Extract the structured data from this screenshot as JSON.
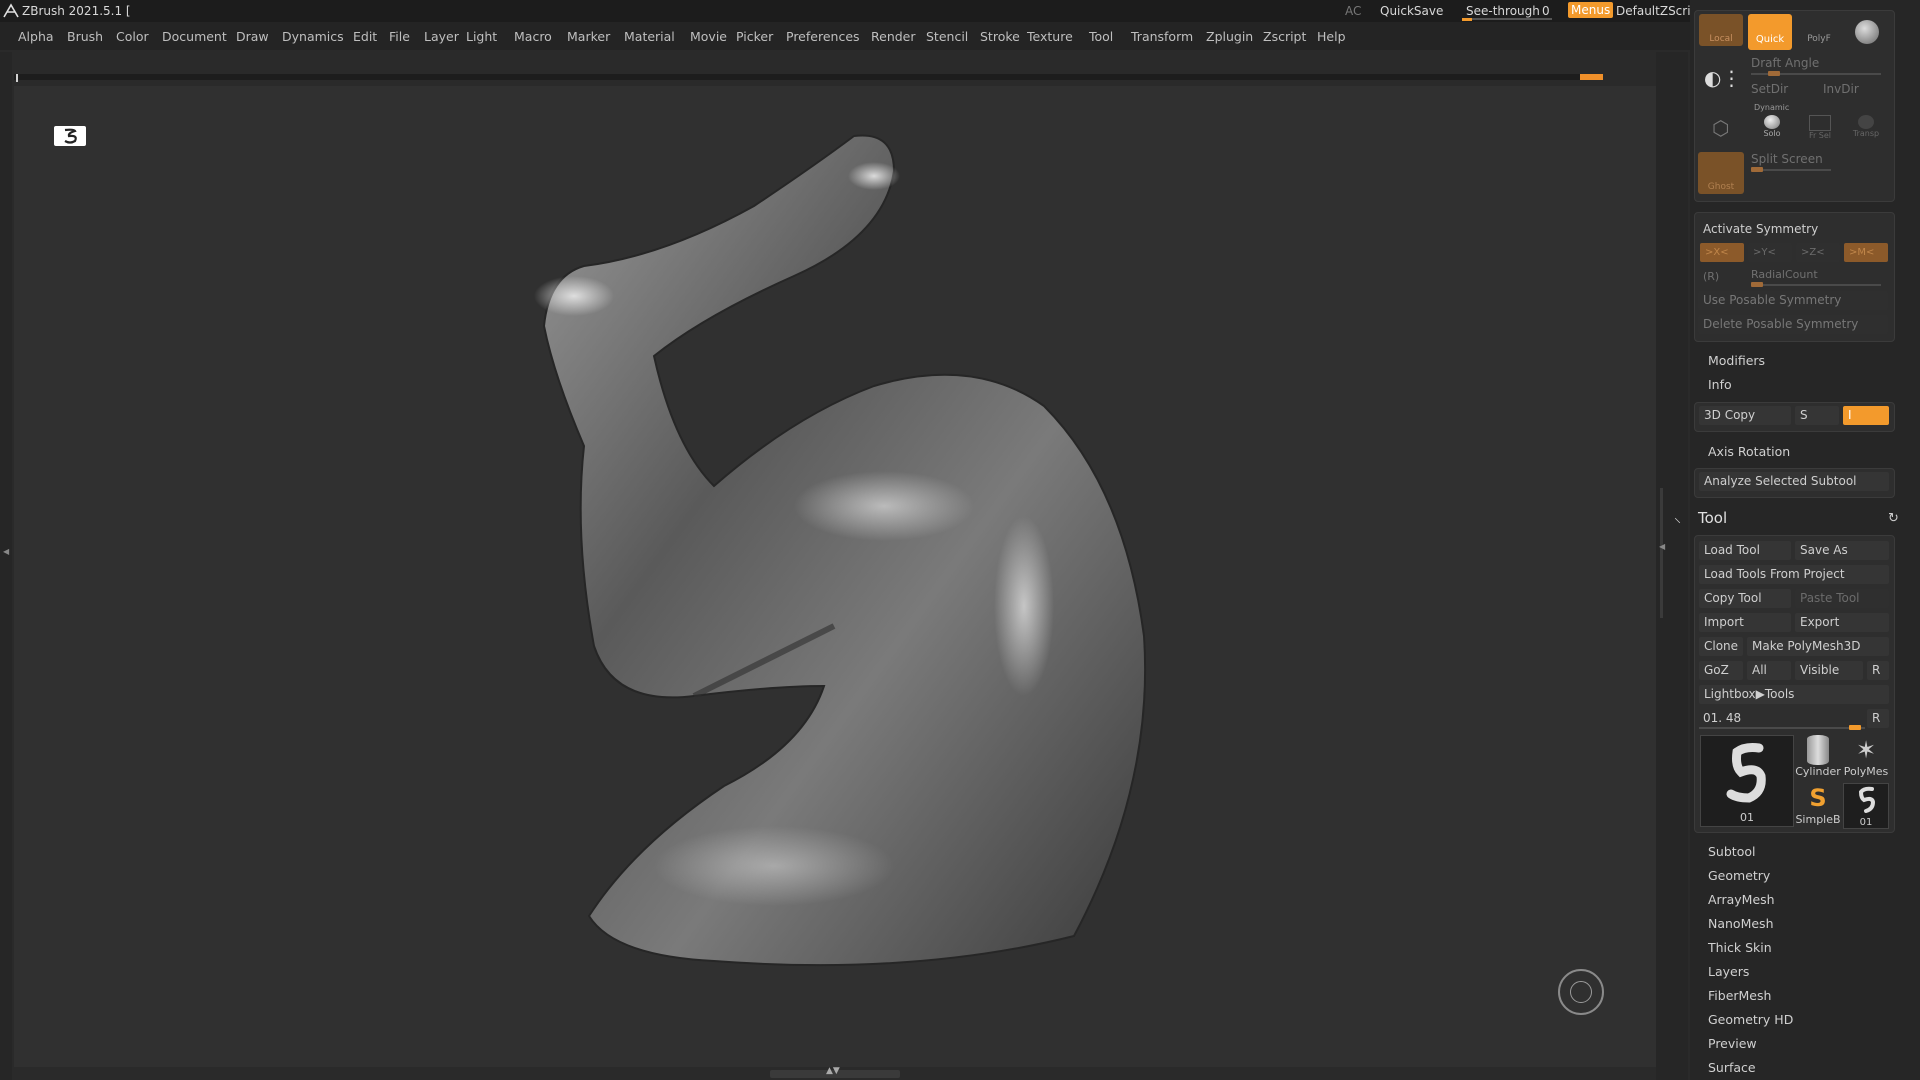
{
  "app": {
    "title": "ZBrush 2021.5.1 [",
    "ac": "AC",
    "quicksave": "QuickSave",
    "see_through": "See-through",
    "see_through_value": "0",
    "menus": "Menus",
    "default_zscript": "DefaultZScript"
  },
  "menus": [
    "Alpha",
    "Brush",
    "Color",
    "Document",
    "Draw",
    "Dynamics",
    "Edit",
    "File",
    "Layer",
    "Light",
    "Macro",
    "Marker",
    "Material",
    "Movie",
    "Picker",
    "Preferences",
    "Render",
    "Stencil",
    "Stroke",
    "Texture",
    "Tool",
    "Transform",
    "Zplugin",
    "Zscript",
    "Help"
  ],
  "top_tools": {
    "local": "Local",
    "quick": "Quick",
    "polyf": "PolyF",
    "draft_angle": "Draft Angle",
    "setdir": "SetDir",
    "invdir": "InvDir",
    "dynamic": "Dynamic",
    "solo": "Solo",
    "frsel": "Fr Sel",
    "transp": "Transp",
    "split_screen": "Split Screen",
    "ghost": "Ghost"
  },
  "symmetry": {
    "activate": "Activate Symmetry",
    "x": ">X<",
    "y": ">Y<",
    "z": ">Z<",
    "m": ">M<",
    "r": "(R)",
    "radial": "RadialCount",
    "use_posable": "Use Posable Symmetry",
    "delete_posable": "Delete Posable Symmetry"
  },
  "sections_a": {
    "modifiers": "Modifiers",
    "info": "Info",
    "copy3d": "3D Copy",
    "s": "S",
    "i": "I",
    "axis_rotation": "Axis Rotation",
    "analyze": "Analyze Selected Subtool"
  },
  "tool": {
    "header": "Tool",
    "load_tool": "Load Tool",
    "save_as": "Save As",
    "load_from_project": "Load Tools From Project",
    "copy_tool": "Copy Tool",
    "paste_tool": "Paste Tool",
    "import": "Import",
    "export": "Export",
    "clone": "Clone",
    "make_polymesh": "Make PolyMesh3D",
    "goz": "GoZ",
    "all": "All",
    "visible": "Visible",
    "r": "R",
    "lightbox": "Lightbox▶Tools",
    "slider_value": "01. 48",
    "slider_r": "R",
    "thumbs": {
      "main": "01",
      "cylinder": "Cylinder",
      "polymesh": "PolyMes",
      "simpleb": "SimpleB",
      "small": "01"
    }
  },
  "tool_sections": [
    "Subtool",
    "Geometry",
    "ArrayMesh",
    "NanoMesh",
    "Thick Skin",
    "Layers",
    "FiberMesh",
    "Geometry HD",
    "Preview",
    "Surface"
  ],
  "accent_color": "#f39a2c"
}
